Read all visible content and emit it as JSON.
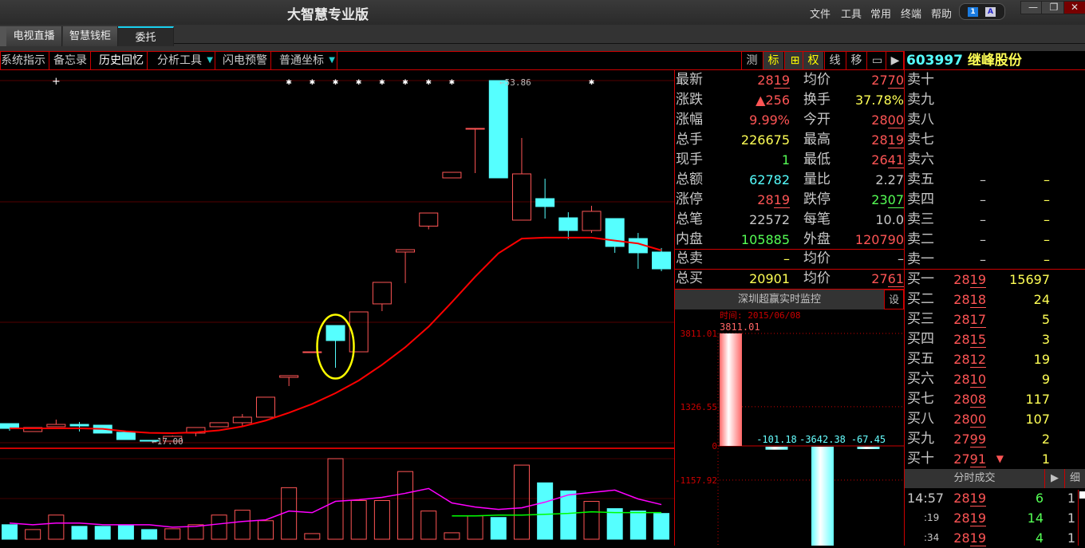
{
  "app": {
    "title": "大智慧专业版",
    "menu": [
      "文件",
      "工具",
      "常用",
      "终端",
      "帮助"
    ],
    "tray_icons": [
      "screen-1-icon",
      "font-a-icon"
    ],
    "window_controls": [
      "minimize",
      "restore",
      "close"
    ]
  },
  "tabs": [
    {
      "label": "电视直播"
    },
    {
      "label": "智慧钱柜"
    },
    {
      "label": "委托",
      "active": true
    }
  ],
  "toolbar": {
    "items": [
      "系统指示",
      "备忘录",
      "历史回忆",
      "分析工具",
      "闪电预警",
      "普通坐标"
    ],
    "right_buttons": [
      "测",
      "标",
      "⊞",
      "权",
      "线",
      "移",
      "▭",
      "▶"
    ]
  },
  "stock": {
    "code": "603997",
    "name": "继峰股份"
  },
  "quote": {
    "rows": [
      {
        "l1": "最新",
        "v1": "2819",
        "c1": "red",
        "p1": true,
        "l2": "均价",
        "v2": "2770",
        "c2": "red",
        "p2": true
      },
      {
        "l1": "涨跌",
        "v1": "▲256",
        "c1": "red",
        "p1": true,
        "l2": "换手",
        "v2": "37.78%",
        "c2": "yel"
      },
      {
        "l1": "涨幅",
        "v1": "9.99%",
        "c1": "red",
        "l2": "今开",
        "v2": "2800",
        "c2": "red",
        "p2": true
      },
      {
        "l1": "总手",
        "v1": "226675",
        "c1": "yel",
        "l2": "最高",
        "v2": "2819",
        "c2": "red",
        "p2": true
      },
      {
        "l1": "现手",
        "v1": "1",
        "c1": "grn",
        "l2": "最低",
        "v2": "2641",
        "c2": "red",
        "p2": true
      },
      {
        "l1": "总额",
        "v1": "62782",
        "c1": "cyn",
        "l2": "量比",
        "v2": "2.27",
        "c2": "gry"
      },
      {
        "l1": "涨停",
        "v1": "2819",
        "c1": "red",
        "p1": true,
        "l2": "跌停",
        "v2": "2307",
        "c2": "grn",
        "p2": true
      },
      {
        "l1": "总笔",
        "v1": "22572",
        "c1": "gry",
        "l2": "每笔",
        "v2": "10.0",
        "c2": "gry"
      },
      {
        "l1": "内盘",
        "v1": "105885",
        "c1": "grn",
        "l2": "外盘",
        "v2": "120790",
        "c2": "red"
      }
    ],
    "total_sell": {
      "label": "总卖",
      "value": "–",
      "avg_label": "均价",
      "avg": "–"
    },
    "total_buy": {
      "label": "总买",
      "value": "20901",
      "avg_label": "均价",
      "avg": "2761"
    }
  },
  "orderbook": {
    "asks": [
      {
        "label": "卖十",
        "price": "",
        "vol": ""
      },
      {
        "label": "卖九",
        "price": "",
        "vol": ""
      },
      {
        "label": "卖八",
        "price": "",
        "vol": ""
      },
      {
        "label": "卖七",
        "price": "",
        "vol": ""
      },
      {
        "label": "卖六",
        "price": "",
        "vol": ""
      },
      {
        "label": "卖五",
        "price": "–",
        "vol": "–"
      },
      {
        "label": "卖四",
        "price": "–",
        "vol": "–"
      },
      {
        "label": "卖三",
        "price": "–",
        "vol": "–"
      },
      {
        "label": "卖二",
        "price": "–",
        "vol": "–"
      },
      {
        "label": "卖一",
        "price": "–",
        "vol": "–"
      }
    ],
    "bids": [
      {
        "label": "买一",
        "price": "2819",
        "vol": "15697"
      },
      {
        "label": "买二",
        "price": "2818",
        "vol": "24"
      },
      {
        "label": "买三",
        "price": "2817",
        "vol": "5"
      },
      {
        "label": "买四",
        "price": "2815",
        "vol": "3"
      },
      {
        "label": "买五",
        "price": "2812",
        "vol": "19"
      },
      {
        "label": "买六",
        "price": "2810",
        "vol": "9"
      },
      {
        "label": "买七",
        "price": "2808",
        "vol": "117"
      },
      {
        "label": "买八",
        "price": "2800",
        "vol": "107"
      },
      {
        "label": "买九",
        "price": "2799",
        "vol": "2"
      },
      {
        "label": "买十",
        "price": "2791",
        "vol": "1",
        "mark": "▼"
      }
    ]
  },
  "trades": {
    "title": "分时成交",
    "play": "▶",
    "detail": "细",
    "rows": [
      {
        "time": "14:57",
        "price": "2819",
        "vol": "6",
        "count": "1"
      },
      {
        "time": ":19",
        "price": "2819",
        "vol": "14",
        "count": "1"
      },
      {
        "time": ":34",
        "price": "2819",
        "vol": "4",
        "count": "1"
      }
    ]
  },
  "monitor": {
    "title": "深圳超赢实时监控",
    "settings": "设",
    "time_label": "时间: 2015/06/08",
    "chart_data": {
      "type": "bar",
      "values": [
        3811.01,
        -101.18,
        -3642.38,
        -67.45
      ],
      "value_labels": [
        "3811.01",
        "-101.18",
        "-3642.38",
        "-67.45"
      ],
      "yticks": [
        "3811.01",
        "1326.55",
        "0",
        "-1157.92"
      ],
      "ytick_values": [
        3811.01,
        1326.55,
        0,
        -1157.92
      ],
      "colors": {
        "positive": "#ff6666",
        "negative": "#66ffff"
      }
    }
  },
  "chart_data": {
    "type": "candlestick",
    "labels": {
      "high": "53.86",
      "low": "17.00"
    },
    "ohlc": [
      [
        18.79,
        18.3,
        18.79,
        18.06
      ],
      [
        17.98,
        18.39,
        18.39,
        17.98
      ],
      [
        18.47,
        18.71,
        19.2,
        18.47
      ],
      [
        18.71,
        18.55,
        18.96,
        17.98
      ],
      [
        18.63,
        17.82,
        18.63,
        17.82
      ],
      [
        17.9,
        17.16,
        17.9,
        17.16
      ],
      [
        17.08,
        17.0,
        17.08,
        17.0
      ],
      [
        17.0,
        17.49,
        17.57,
        17.0
      ],
      [
        17.82,
        18.39,
        18.39,
        17.49
      ],
      [
        18.47,
        18.88,
        18.88,
        18.47
      ],
      [
        18.88,
        19.45,
        19.77,
        18.55
      ],
      [
        19.45,
        21.49,
        21.49,
        19.45
      ],
      [
        23.52,
        23.69,
        23.69,
        22.63
      ],
      [
        26.13,
        26.13,
        26.13,
        26.13
      ],
      [
        28.82,
        27.28,
        28.82,
        24.5
      ],
      [
        26.13,
        30.21,
        30.21,
        26.13
      ],
      [
        31.03,
        33.23,
        33.23,
        30.29
      ],
      [
        36.33,
        36.57,
        36.57,
        33.15
      ],
      [
        38.98,
        40.32,
        40.32,
        38.65
      ],
      [
        43.91,
        44.48,
        44.48,
        43.91
      ],
      [
        48.97,
        48.97,
        48.97,
        44.4
      ],
      [
        53.86,
        43.91,
        53.86,
        43.91
      ],
      [
        39.59,
        44.32,
        47.99,
        39.59
      ],
      [
        41.79,
        40.98,
        43.83,
        39.75
      ],
      [
        39.83,
        38.53,
        40.4,
        37.63
      ],
      [
        38.53,
        40.49,
        41.06,
        38.28
      ],
      [
        39.75,
        36.9,
        39.75,
        36.25
      ],
      [
        37.71,
        36.25,
        38.28,
        34.61
      ],
      [
        36.33,
        34.61,
        36.74,
        34.37
      ]
    ],
    "ma": [
      18.3,
      18.3,
      18.3,
      18.3,
      18.25,
      18.0,
      17.85,
      17.82,
      17.9,
      18.1,
      18.5,
      19.1,
      19.9,
      20.8,
      21.9,
      23.2,
      24.8,
      26.6,
      28.7,
      31.2,
      33.8,
      36.2,
      37.7,
      37.8,
      37.8,
      37.8,
      37.5,
      37.2,
      36.5
    ],
    "signal_markers": [
      {
        "index": 2,
        "symbol": "+"
      },
      {
        "index": 12,
        "symbol": "✱"
      },
      {
        "index": 13,
        "symbol": "✱"
      },
      {
        "index": 14,
        "symbol": "✱"
      },
      {
        "index": 15,
        "symbol": "✱"
      },
      {
        "index": 16,
        "symbol": "✱"
      },
      {
        "index": 17,
        "symbol": "✱"
      },
      {
        "index": 18,
        "symbol": "✱"
      },
      {
        "index": 19,
        "symbol": "✱"
      },
      {
        "index": 25,
        "symbol": "✱"
      }
    ],
    "highlight_index": 14,
    "volume": [
      18,
      12,
      30,
      16,
      16,
      17,
      12,
      13,
      18,
      30,
      36,
      23,
      64,
      7,
      100,
      48,
      48,
      84,
      35,
      8,
      29,
      27,
      92,
      70,
      60,
      47,
      38,
      35,
      32
    ],
    "volume_up": [
      false,
      true,
      true,
      false,
      false,
      false,
      false,
      true,
      true,
      true,
      true,
      true,
      true,
      true,
      true,
      true,
      true,
      true,
      true,
      true,
      true,
      false,
      true,
      false,
      false,
      true,
      false,
      false,
      false
    ],
    "volume_ma": [
      20,
      18,
      20,
      20,
      18,
      18,
      18,
      15,
      16,
      19,
      22,
      24,
      35,
      33,
      47,
      49,
      52,
      57,
      63,
      45,
      40,
      37,
      39,
      46,
      55,
      58,
      61,
      50,
      43
    ],
    "volume_ma2": {
      "start_index": 19,
      "values": [
        29,
        29,
        30,
        30,
        31,
        32,
        34,
        33,
        33,
        33
      ]
    },
    "colors": {
      "up": "#ff5555",
      "down": "#55ffff",
      "ma": "#ff0000",
      "vol_ma": "#ff00ff",
      "vol_ma2": "#00ff00",
      "highlight": "#ffff00"
    }
  }
}
